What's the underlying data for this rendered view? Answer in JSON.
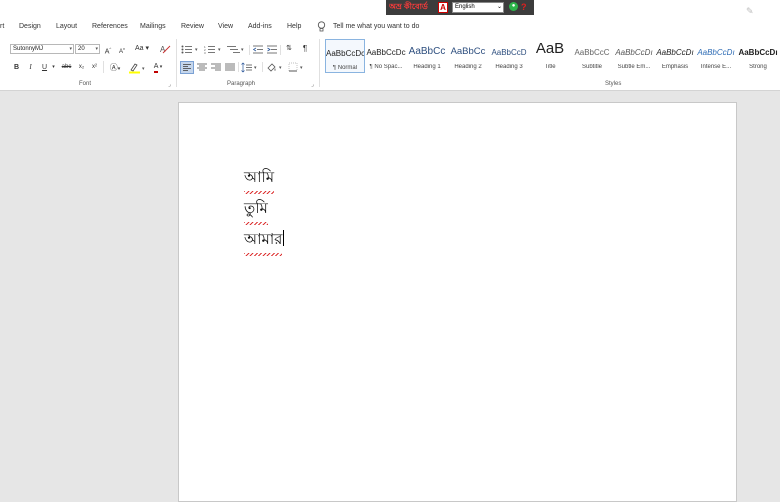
{
  "ime_bar": {
    "logo_text": "অভ্র কীবোর্ড",
    "language": "English"
  },
  "menu": {
    "items": [
      "rt",
      "Design",
      "Layout",
      "References",
      "Mailings",
      "Review",
      "View",
      "Add-ins",
      "Help"
    ],
    "tell_me": "Tell me what you want to do"
  },
  "font": {
    "name": "SutonnyMJ",
    "size": "20",
    "grow": "A",
    "shrink": "A",
    "case": "Aa",
    "bold": "B",
    "italic": "I",
    "underline": "U",
    "strike": "abc",
    "subscript": "x₂",
    "superscript": "x²",
    "color_letter": "A",
    "group_label": "Font"
  },
  "paragraph": {
    "group_label": "Paragraph",
    "show_marks": "¶"
  },
  "styles": {
    "group_label": "Styles",
    "items": [
      {
        "preview": "AaBbCcDc",
        "name": "¶ Normal"
      },
      {
        "preview": "AaBbCcDc",
        "name": "¶ No Spac..."
      },
      {
        "preview": "AaBbCc",
        "name": "Heading 1"
      },
      {
        "preview": "AaBbCc",
        "name": "Heading 2"
      },
      {
        "preview": "AaBbCcD",
        "name": "Heading 3"
      },
      {
        "preview": "AaB",
        "name": "Title"
      },
      {
        "preview": "AaBbCcC",
        "name": "Subtitle"
      },
      {
        "preview": "AaBbCcDı",
        "name": "Subtle Em..."
      },
      {
        "preview": "AaBbCcDı",
        "name": "Emphasis"
      },
      {
        "preview": "AaBbCcDı",
        "name": "Intense E..."
      },
      {
        "preview": "AaBbCcDı",
        "name": "Strong"
      }
    ]
  },
  "document": {
    "lines": [
      "আমি",
      "তুমি",
      "আমার"
    ]
  },
  "colors": {
    "accent": "#2b579a",
    "highlight": "#ffff00",
    "font_color": "#c00000"
  }
}
